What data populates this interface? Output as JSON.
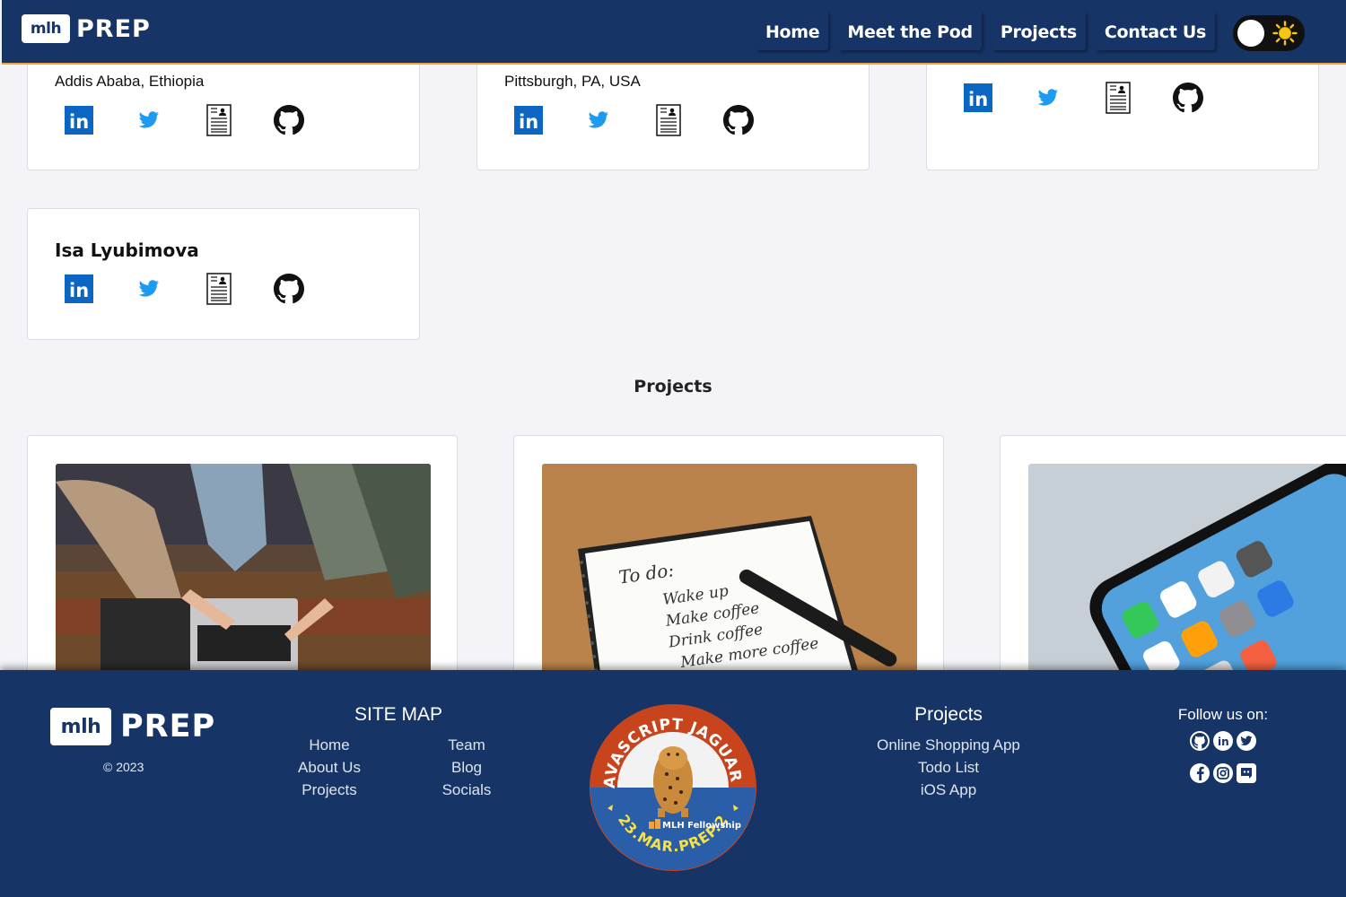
{
  "brand": {
    "logo_mark": "mlh",
    "logo_text": "PREP"
  },
  "nav": {
    "links": [
      "Home",
      "Meet the Pod",
      "Projects",
      "Contact Us"
    ],
    "theme_toggle": {
      "state": "light",
      "icon": "sun-icon"
    }
  },
  "team": {
    "cards": [
      {
        "location": "Addis Ababa, Ethiopia",
        "icons": [
          "linkedin-icon",
          "twitter-icon",
          "resume-icon",
          "github-icon"
        ]
      },
      {
        "location": "Pittsburgh, PA, USA",
        "icons": [
          "linkedin-icon",
          "twitter-icon",
          "resume-icon",
          "github-icon"
        ]
      },
      {
        "location": "",
        "icons": [
          "linkedin-icon",
          "twitter-icon",
          "resume-icon",
          "github-icon"
        ]
      },
      {
        "name": "Isa Lyubimova",
        "icons": [
          "linkedin-icon",
          "twitter-icon",
          "resume-icon",
          "github-icon"
        ]
      }
    ]
  },
  "projects_section": {
    "title": "Projects",
    "cards": [
      {
        "image": "team-laptop-photo"
      },
      {
        "image": "todo-notebook-photo",
        "note_lines": [
          "To do:",
          "Wake up",
          "Make coffee",
          "Drink coffee",
          "Make more coffee"
        ]
      },
      {
        "image": "iphone-homescreen-photo"
      }
    ]
  },
  "footer": {
    "logo_mark": "mlh",
    "logo_text": "PREP",
    "copyright": "© 2023",
    "sitemap": {
      "title": "SITE MAP",
      "col1": [
        "Home",
        "About Us",
        "Projects"
      ],
      "col2": [
        "Team",
        "Blog",
        "Socials"
      ]
    },
    "badge": {
      "top_text": "JAVASCRIPT JAGUARS",
      "bottom_text": "23.MAR.PREP.2",
      "center_label": "MLH Fellowship"
    },
    "projects": {
      "title": "Projects",
      "items": [
        "Online Shopping App",
        "Todo List",
        "iOS App"
      ]
    },
    "follow": {
      "title": "Follow us on:",
      "row1": [
        "github-icon",
        "linkedin-icon",
        "twitter-icon"
      ],
      "row2": [
        "facebook-icon",
        "instagram-icon",
        "discord-icon"
      ]
    }
  },
  "colors": {
    "navy": "#163466",
    "accent_orange": "#f2a33a",
    "linkedin_blue": "#0a66c2",
    "twitter_blue": "#1d9bf0",
    "badge_red": "#c8441c",
    "badge_blue": "#2b5ea8",
    "badge_yellow": "#f5e14a"
  }
}
